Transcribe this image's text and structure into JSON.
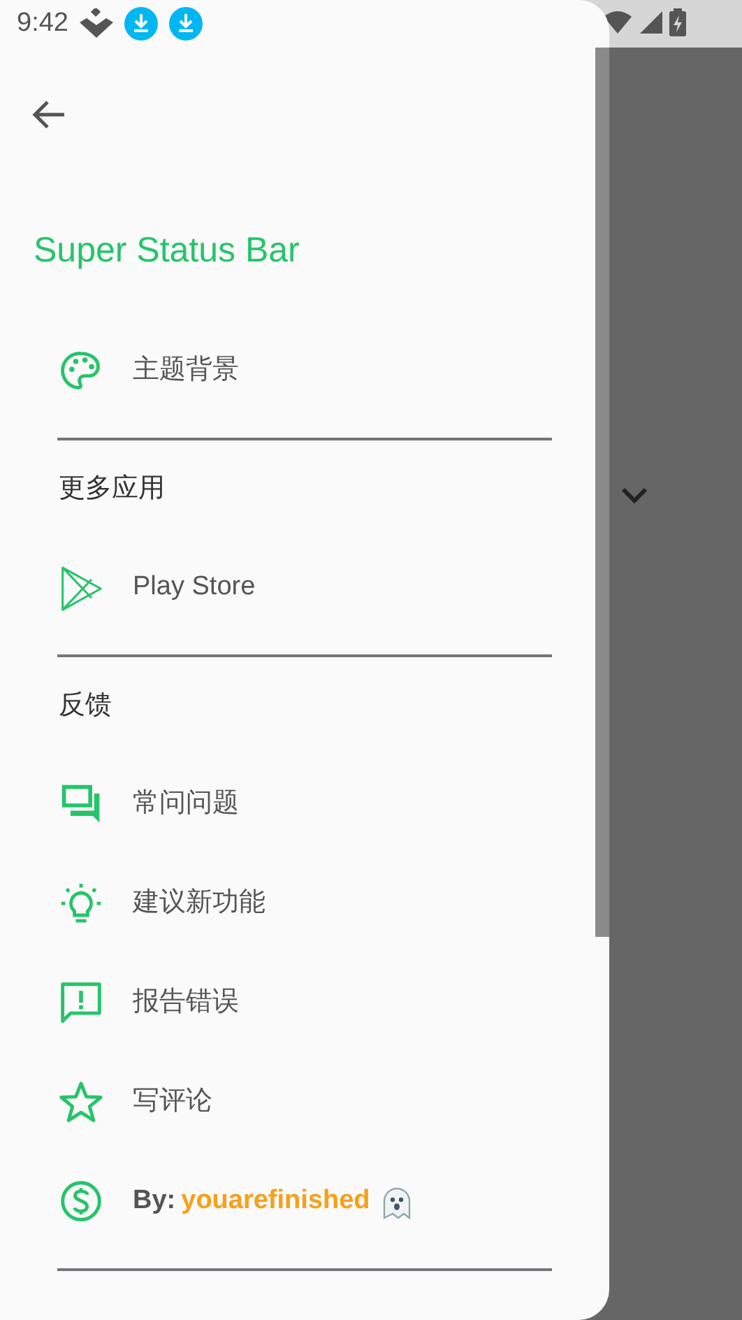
{
  "status_bar": {
    "time": "9:42"
  },
  "drawer": {
    "title": "Super Status Bar",
    "entries": [
      {
        "kind": "item",
        "label": "主题背景"
      },
      {
        "kind": "divider"
      },
      {
        "kind": "header",
        "label": "更多应用"
      },
      {
        "kind": "item",
        "label": "Play Store"
      },
      {
        "kind": "divider"
      },
      {
        "kind": "header",
        "label": "反馈"
      },
      {
        "kind": "item",
        "label": "常问问题"
      },
      {
        "kind": "item",
        "label": "建议新功能"
      },
      {
        "kind": "item",
        "label": "报告错误"
      },
      {
        "kind": "item",
        "label": "写评论"
      },
      {
        "kind": "credit",
        "label": "By:",
        "author": "youarefinished"
      },
      {
        "kind": "divider"
      }
    ]
  }
}
